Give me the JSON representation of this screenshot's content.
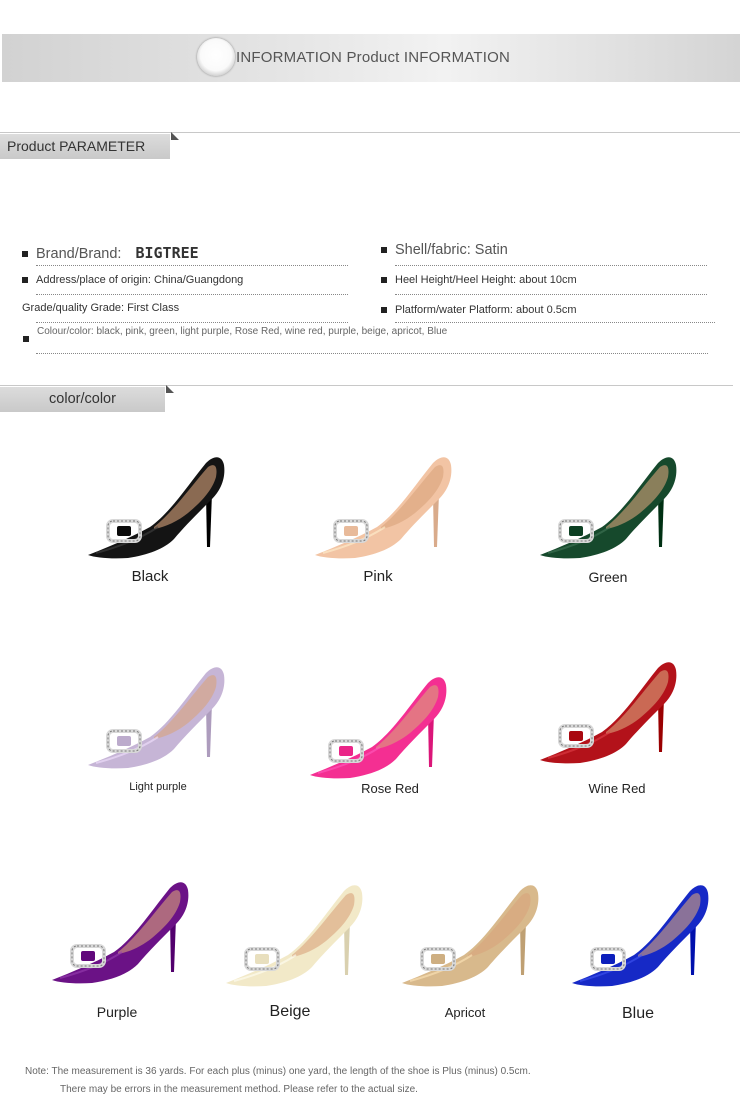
{
  "header": {
    "title": "INFORMATION Product INFORMATION"
  },
  "params_section": {
    "title": "Product PARAMETER"
  },
  "params": {
    "brand_label": "Brand/Brand:",
    "brand_value": "BIGTREE",
    "shell": "Shell/fabric: Satin",
    "address": "Address/place of origin: China/Guangdong",
    "heel": "Heel Height/Heel Height: about 10cm",
    "grade": "Grade/quality Grade: First Class",
    "platform": "Platform/water Platform: about 0.5cm",
    "colour": "Colour/color: black, pink, green, light purple, Rose Red, wine red, purple, beige, apricot, Blue"
  },
  "color_section": {
    "title": "color/color"
  },
  "colors": [
    {
      "name": "Black",
      "hex": "#141414"
    },
    {
      "name": "Pink",
      "hex": "#f2c4a4"
    },
    {
      "name": "Green",
      "hex": "#16492c"
    },
    {
      "name": "Light purple",
      "hex": "#c6b5d6"
    },
    {
      "name": "Rose Red",
      "hex": "#f42f92"
    },
    {
      "name": "Wine Red",
      "hex": "#b3121a"
    },
    {
      "name": "Purple",
      "hex": "#6b1286"
    },
    {
      "name": "Beige",
      "hex": "#f2e9c8"
    },
    {
      "name": "Apricot",
      "hex": "#d8b98c"
    },
    {
      "name": "Blue",
      "hex": "#1629c6"
    }
  ],
  "notes": {
    "line1": "Note: The measurement is 36 yards. For each plus (minus) one yard, the length of the shoe is Plus (minus) 0.5cm.",
    "line2": "There may be errors in the measurement method. Please refer to the actual size."
  }
}
